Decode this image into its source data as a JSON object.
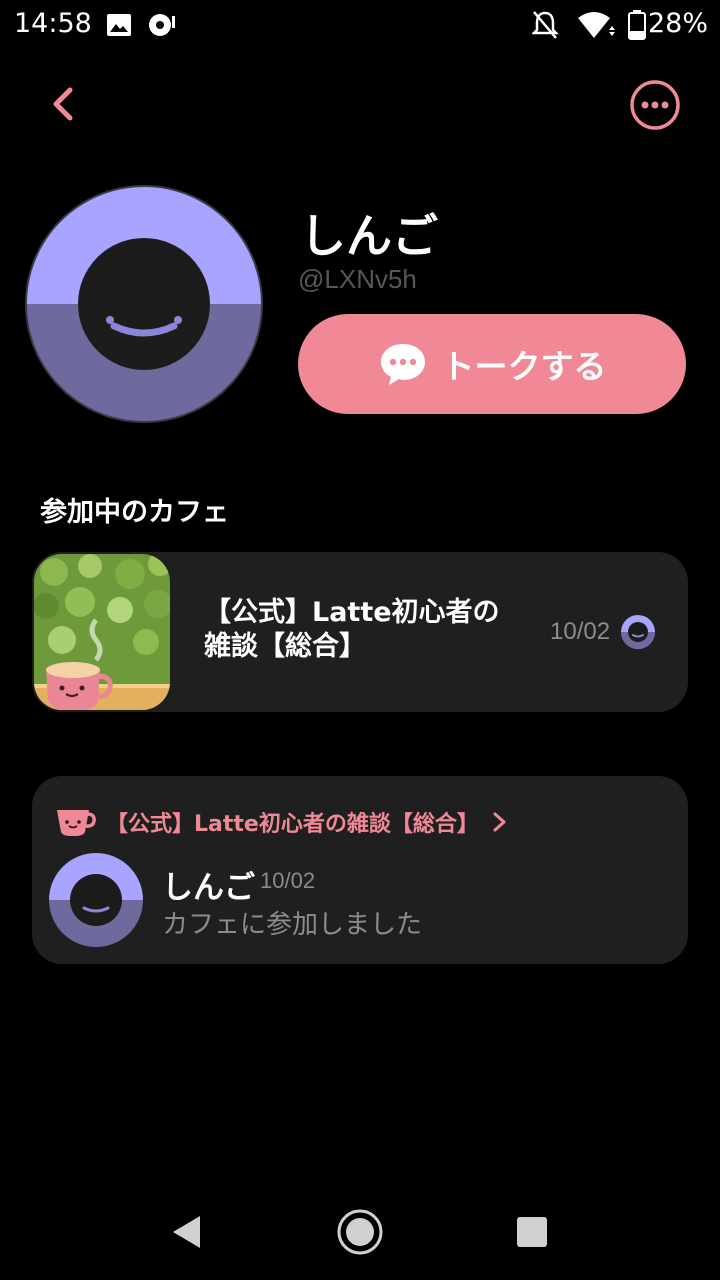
{
  "status_bar": {
    "time": "14:58",
    "battery": "28%",
    "icons": [
      "image-icon",
      "media-icon",
      "bell-off-icon",
      "wifi-icon",
      "battery-icon"
    ]
  },
  "header": {
    "back_icon": "chevron-left-icon",
    "more_icon": "more-horizontal-icon"
  },
  "profile": {
    "name": "しんご",
    "handle": "@LXNv5h",
    "talk_button_label": "トークする",
    "talk_icon": "chat-bubble-icon"
  },
  "cafes_section": {
    "title": "参加中のカフェ",
    "items": [
      {
        "title": "【公式】Latte初心者の雑談【総合】",
        "date": "10/02"
      }
    ]
  },
  "activity": {
    "cafe_link": "【公式】Latte初心者の雑談【総合】",
    "user": "しんご",
    "date": "10/02",
    "text": "カフェに参加しました"
  },
  "colors": {
    "accent": "#f08896",
    "avatar_top": "#a8a4ff",
    "avatar_bottom": "#6e6a9e",
    "card_bg": "#1f1f1f"
  }
}
